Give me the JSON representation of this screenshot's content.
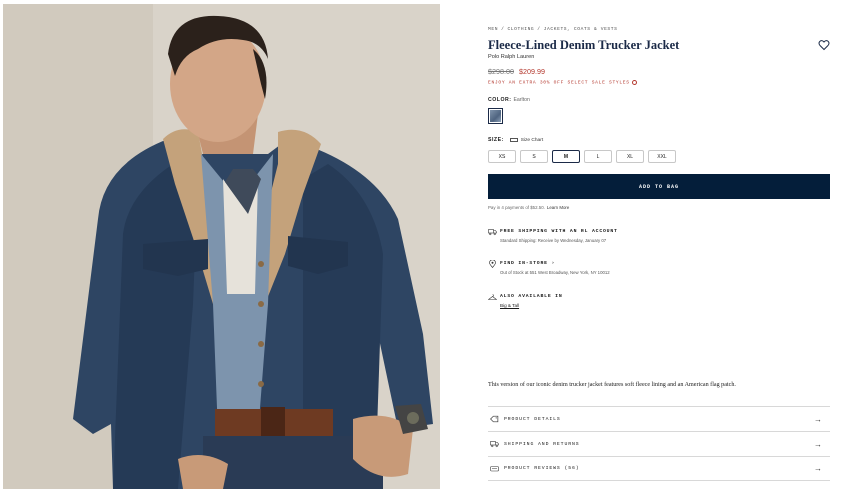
{
  "breadcrumb": [
    "Men",
    "Clothing",
    "Jackets, Coats & Vests"
  ],
  "product": {
    "title": "Fleece-Lined Denim Trucker Jacket",
    "brand": "Polo Ralph Lauren",
    "price_original": "$298.00",
    "price_sale": "$209.99",
    "promo": "ENJOY AN EXTRA 30% OFF SELECT SALE STYLES",
    "color_label": "COLOR:",
    "color_value": "Earlton",
    "size_label": "SIZE:",
    "size_chart": "Size Chart",
    "sizes": [
      "XS",
      "S",
      "M",
      "L",
      "XL",
      "XXL"
    ],
    "selected_size": "M",
    "add_to_bag": "ADD TO BAG",
    "installments": "Pay in 4 payments of $52.50.",
    "learn_more": "Learn More",
    "description": "This version of our iconic denim trucker jacket features soft fleece lining and an American flag patch."
  },
  "features": [
    {
      "icon": "truck-icon",
      "title": "FREE SHIPPING WITH AN RL ACCOUNT",
      "sub": "Standard Shipping: Receive by Wednesday, January 07"
    },
    {
      "icon": "location-pin-icon",
      "title": "FIND IN-STORE",
      "sub": "Out of Stock at 551 West Broadway, New York, NY 10012"
    },
    {
      "icon": "hanger-icon",
      "title": "ALSO AVAILABLE IN",
      "link": "Big & Tall"
    }
  ],
  "accordions": [
    {
      "icon": "tag-icon",
      "label": "PRODUCT DETAILS"
    },
    {
      "icon": "truck-icon",
      "label": "SHIPPING AND RETURNS"
    },
    {
      "icon": "reviews-icon",
      "label": "PRODUCT REVIEWS (56)"
    }
  ],
  "colors": {
    "navy": "#041e3a",
    "sale_red": "#b4392f",
    "title_navy": "#1b2a47"
  }
}
